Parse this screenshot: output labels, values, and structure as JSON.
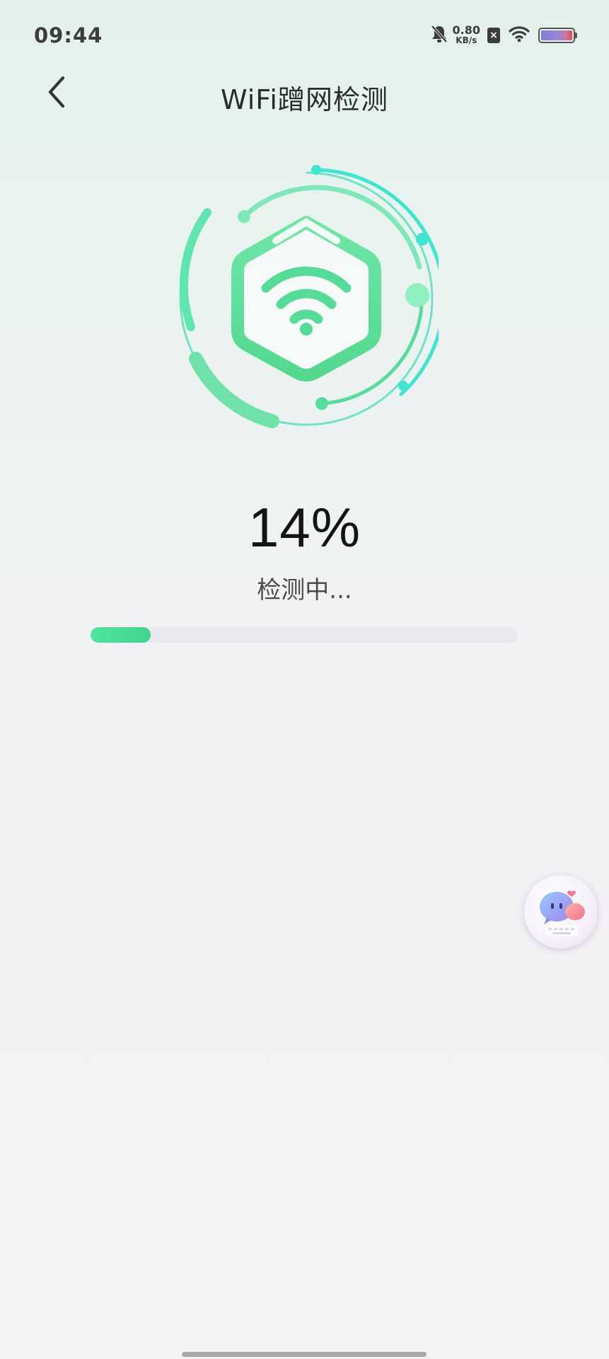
{
  "status_bar": {
    "time": "09:44",
    "net_speed_value": "0.80",
    "net_speed_unit": "KB/s",
    "sim_badge": "×",
    "icons": [
      "mute-bell-icon",
      "sim-off-icon",
      "wifi-signal-icon",
      "battery-icon"
    ]
  },
  "header": {
    "title": "WiFi蹭网检测",
    "back_icon": "chevron-left-icon"
  },
  "scan": {
    "icon": "wifi-icon",
    "percent_text": "14%",
    "progress": 0.14,
    "status": "检测中..."
  },
  "floating_assistant": {
    "icon": "chat-assistant-icon"
  },
  "colors": {
    "accent": "#4fe39f",
    "ring_cyan": "#3ee6d0",
    "hexagon_green": "#62e39f"
  }
}
